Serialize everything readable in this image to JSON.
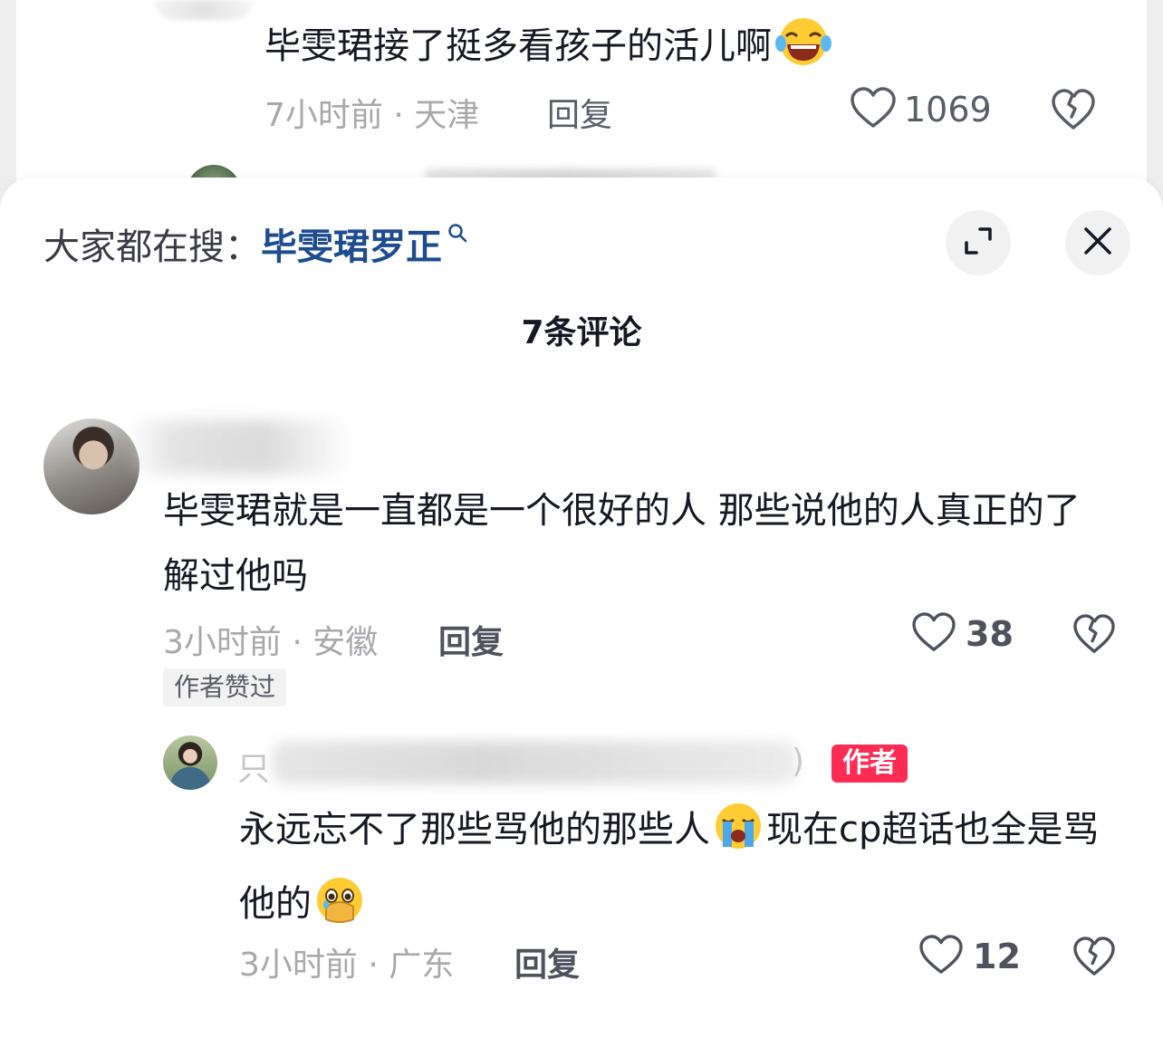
{
  "background_comment": {
    "text": "毕雯珺接了挺多看孩子的活儿啊",
    "emoji": "laughing-tears-emoji",
    "time": "7小时前",
    "location": "天津",
    "reply_label": "回复",
    "like_count": "1069"
  },
  "sheet": {
    "search_prefix": "大家都在搜：",
    "search_term": "毕雯珺罗正",
    "title": "7条评论",
    "icons": [
      "search-icon",
      "expand-icon",
      "close-icon"
    ]
  },
  "comments": [
    {
      "text": "毕雯珺就是一直都是一个很好的人 那些说他的人真正的了解过他吗",
      "time": "3小时前",
      "location": "安徽",
      "reply_label": "回复",
      "like_count": "38",
      "badge": "作者赞过",
      "replies": [
        {
          "name_first_char": "只",
          "name_tail": ")",
          "author_badge": "作者",
          "text_part1": "永远忘不了那些骂他的那些人",
          "text_part2": "现在cp超话也全是骂他的",
          "emojis": [
            "crying-emoji",
            "holding-back-tears-emoji"
          ],
          "time": "3小时前",
          "location": "广东",
          "reply_label": "回复",
          "like_count": "12"
        }
      ]
    }
  ],
  "colors": {
    "link_blue": "#1e4c8f",
    "author_red": "#fe2c55",
    "meta_gray": "#a8a8ad"
  },
  "separator": "·"
}
